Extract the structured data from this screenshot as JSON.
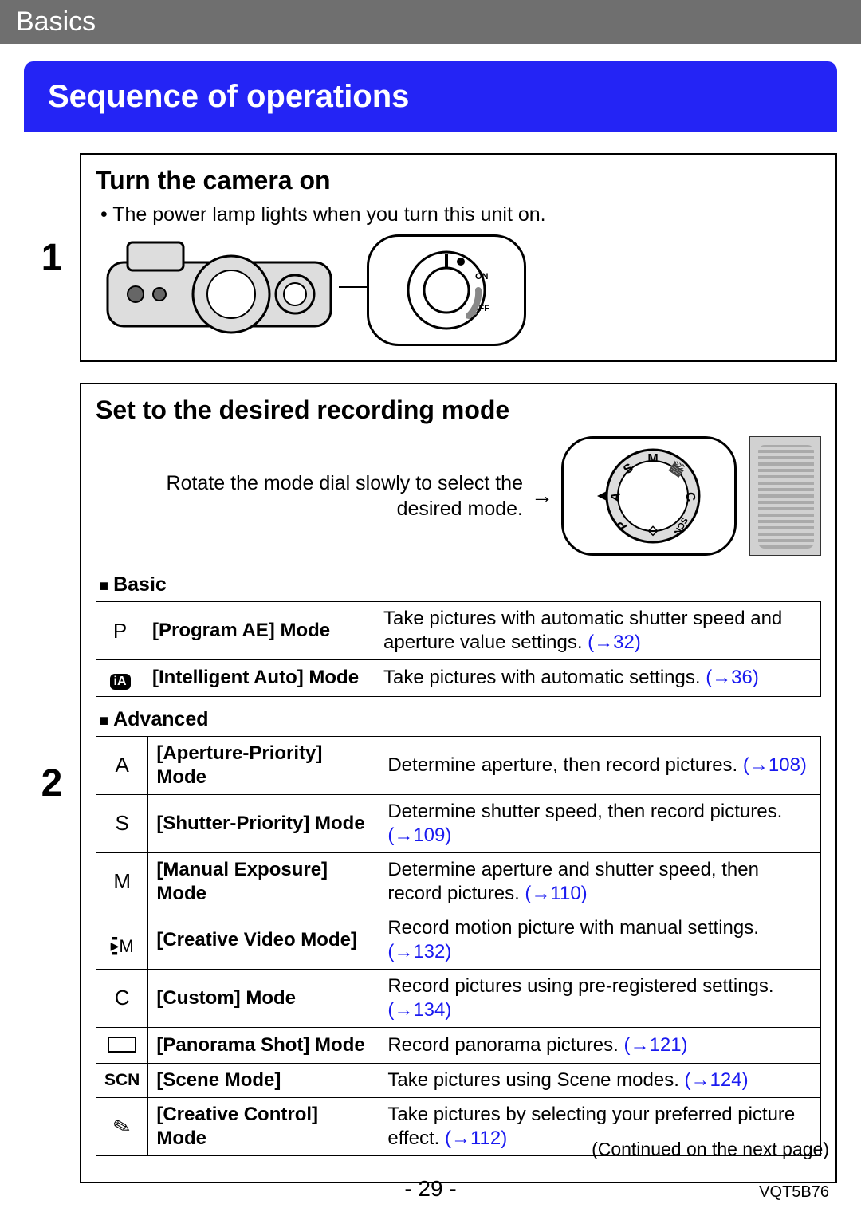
{
  "header": {
    "section": "Basics"
  },
  "title": "Sequence of operations",
  "steps": {
    "one": {
      "num": "1",
      "title": "Turn the camera on",
      "bullet": "• The power lamp lights when you turn this unit on.",
      "dial_on": "ON",
      "dial_off": "OFF"
    },
    "two": {
      "num": "2",
      "title": "Set to the desired recording mode",
      "instruction": "Rotate the mode dial slowly to select the desired mode.",
      "arrow": "→"
    }
  },
  "groups": {
    "basic": "Basic",
    "advanced": "Advanced"
  },
  "basic_modes": [
    {
      "icon": "P",
      "name": "[Program AE] Mode",
      "desc": "Take pictures with automatic shutter speed and aperture value settings. ",
      "xref": "(→32)"
    },
    {
      "icon": "iA",
      "name": "[Intelligent Auto] Mode",
      "desc": "Take pictures with automatic settings. ",
      "xref": "(→36)"
    }
  ],
  "advanced_modes": [
    {
      "icon": "A",
      "name": "[Aperture-Priority] Mode",
      "desc": "Determine aperture, then record pictures. ",
      "xref": "(→108)"
    },
    {
      "icon": "S",
      "name": "[Shutter-Priority] Mode",
      "desc": "Determine shutter speed, then record pictures. ",
      "xref": "(→109)"
    },
    {
      "icon": "M",
      "name": "[Manual Exposure] Mode",
      "desc": "Determine aperture and shutter speed, then record pictures. ",
      "xref": "(→110)"
    },
    {
      "icon": "videoM",
      "name": "[Creative Video Mode]",
      "desc": "Record motion picture with manual settings. ",
      "xref": "(→132)"
    },
    {
      "icon": "C",
      "name": "[Custom] Mode",
      "desc": "Record pictures using pre-registered settings. ",
      "xref": "(→134)"
    },
    {
      "icon": "panorama",
      "name": "[Panorama Shot] Mode",
      "desc": "Record panorama pictures. ",
      "xref": "(→121)"
    },
    {
      "icon": "SCN",
      "name": "[Scene Mode]",
      "desc": "Take pictures using Scene modes. ",
      "xref": "(→124)"
    },
    {
      "icon": "palette",
      "name": "[Creative Control] Mode",
      "desc": "Take pictures by selecting your preferred picture effect. ",
      "xref": "(→112)"
    }
  ],
  "footer": {
    "continued": "(Continued on the next page)",
    "page": "- 29 -",
    "doc_id": "VQT5B76"
  },
  "dial_letters": [
    "A",
    "S",
    "M",
    "P",
    "C",
    "SCN"
  ]
}
